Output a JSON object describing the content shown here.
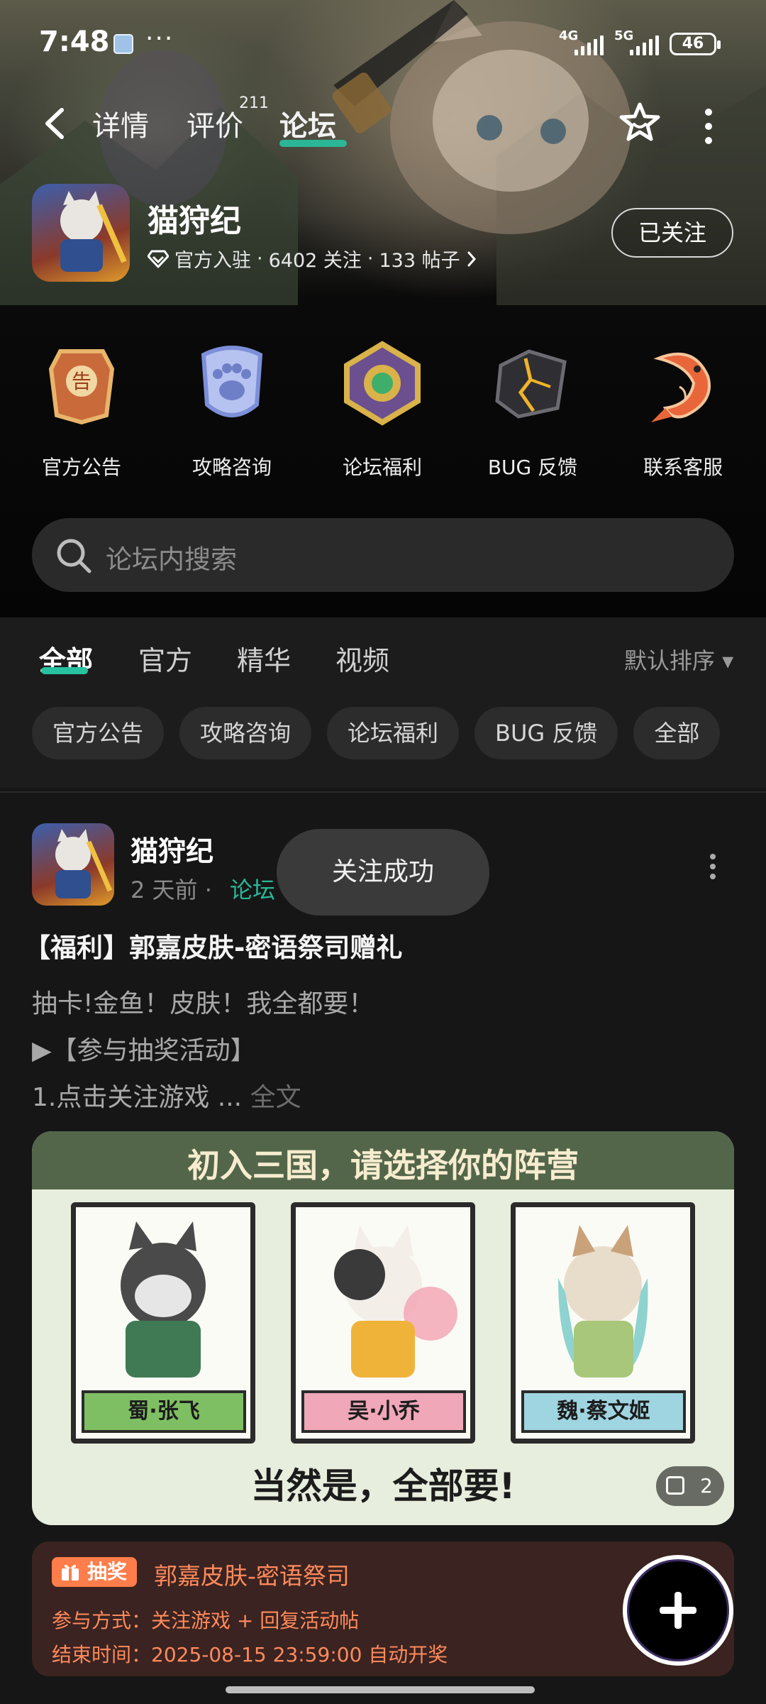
{
  "status_bar": {
    "time": "7:48",
    "more": "···",
    "signal_1": "4G",
    "signal_2": "5G",
    "battery": "46"
  },
  "nav": {
    "tabs": [
      {
        "label": "详情"
      },
      {
        "label": "评价",
        "count": "211"
      },
      {
        "label": "论坛",
        "active": true
      }
    ]
  },
  "game": {
    "name": "猫狩纪",
    "official": "官方入驻",
    "followers": "6402 关注",
    "posts": "133 帖子",
    "follow_button": "已关注"
  },
  "quick_links": [
    {
      "label": "官方公告",
      "icon": "announcement-badge-icon"
    },
    {
      "label": "攻略咨询",
      "icon": "paw-shield-icon"
    },
    {
      "label": "论坛福利",
      "icon": "jade-token-icon"
    },
    {
      "label": "BUG 反馈",
      "icon": "cracked-crystal-icon"
    },
    {
      "label": "联系客服",
      "icon": "koi-fish-icon"
    }
  ],
  "search": {
    "placeholder": "论坛内搜索"
  },
  "feed_tabs": [
    {
      "label": "全部",
      "active": true
    },
    {
      "label": "官方"
    },
    {
      "label": "精华"
    },
    {
      "label": "视频"
    }
  ],
  "sort_label": "默认排序 ▾",
  "chips": [
    "官方公告",
    "攻略咨询",
    "论坛福利",
    "BUG 反馈",
    "全部"
  ],
  "post": {
    "author": "猫狩纪",
    "time": "2 天前 ·",
    "forum": "论坛",
    "title": "【福利】郭嘉皮肤-密语祭司赠礼",
    "line1": "抽卡!金鱼！皮肤！我全都要！",
    "line2": "▶【参与抽奖活动】",
    "line3": "1.点击关注游戏 ...",
    "read_more": "全文",
    "image": {
      "header": "初入三国，请选择你的阵营",
      "cards": [
        {
          "label": "蜀·张飞",
          "color": "#7fbf63"
        },
        {
          "label": "吴·小乔",
          "color": "#f0a7b8"
        },
        {
          "label": "魏·蔡文姬",
          "color": "#9fd5e0"
        }
      ],
      "footer": "当然是，全部要!",
      "count": "2"
    },
    "lottery": {
      "badge": "抽奖",
      "title": "郭嘉皮肤-密语祭司",
      "method": "参与方式：关注游戏 + 回复活动帖",
      "end_time": "结束时间：2025-08-15 23:59:00 自动开奖"
    }
  },
  "toast": "关注成功",
  "colors": {
    "accent": "#27c2a0",
    "lottery": "#ff8a5c"
  }
}
